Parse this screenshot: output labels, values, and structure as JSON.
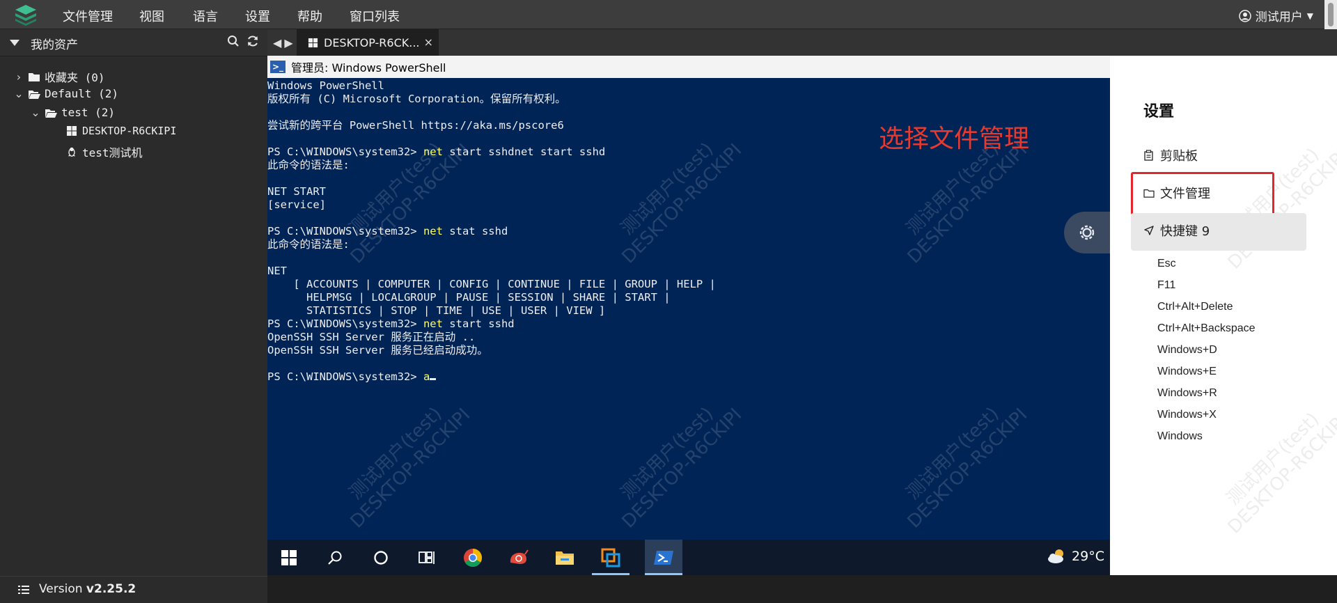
{
  "menubar": {
    "items": [
      "文件管理",
      "视图",
      "语言",
      "设置",
      "帮助",
      "窗口列表"
    ],
    "user": "测试用户"
  },
  "sidebar": {
    "title": "我的资产",
    "tree": [
      {
        "label": "收藏夹 (0)"
      },
      {
        "label": "Default (2)"
      },
      {
        "label": "test (2)"
      },
      {
        "label": "DESKTOP-R6CKIPI"
      },
      {
        "label": "test测试机"
      }
    ],
    "version_label": "Version ",
    "version_value": "v2.25.2"
  },
  "tabbar": {
    "tab_label": "DESKTOP-R6CK...",
    "close_glyph": "×"
  },
  "remote": {
    "window_title": "管理员: Windows PowerShell",
    "terminal_lines": [
      {
        "text": "Windows PowerShell"
      },
      {
        "text": "版权所有 (C) Microsoft Corporation。保留所有权利。"
      },
      {
        "text": ""
      },
      {
        "text": "尝试新的跨平台 PowerShell https://aka.ms/pscore6"
      },
      {
        "text": ""
      },
      {
        "prompt": "PS C:\\WINDOWS\\system32> ",
        "cmd": "net",
        "rest": " start sshdnet start sshd"
      },
      {
        "text": "此命令的语法是:"
      },
      {
        "text": ""
      },
      {
        "text": "NET START"
      },
      {
        "text": "[service]"
      },
      {
        "text": ""
      },
      {
        "prompt": "PS C:\\WINDOWS\\system32> ",
        "cmd": "net",
        "rest": " stat sshd"
      },
      {
        "text": "此命令的语法是:"
      },
      {
        "text": ""
      },
      {
        "text": "NET"
      },
      {
        "text": "    [ ACCOUNTS | COMPUTER | CONFIG | CONTINUE | FILE | GROUP | HELP |"
      },
      {
        "text": "      HELPMSG | LOCALGROUP | PAUSE | SESSION | SHARE | START |"
      },
      {
        "text": "      STATISTICS | STOP | TIME | USE | USER | VIEW ]"
      },
      {
        "prompt": "PS C:\\WINDOWS\\system32> ",
        "cmd": "net",
        "rest": " start sshd"
      },
      {
        "text": "OpenSSH SSH Server 服务正在启动 .."
      },
      {
        "text": "OpenSSH SSH Server 服务已经启动成功。"
      },
      {
        "text": ""
      },
      {
        "prompt": "PS C:\\WINDOWS\\system32> ",
        "cmd": "a",
        "rest": "",
        "cursor": true
      }
    ],
    "annotation": "选择文件管理",
    "watermark": "测试用户(test)\nDESKTOP-R6CKIPI",
    "taskbar": {
      "weather_temp": "29°C"
    }
  },
  "settings": {
    "title": "设置",
    "clipboard": "剪贴板",
    "file_manager": "文件管理",
    "shortcuts": "快捷键 9",
    "keys": [
      "Esc",
      "F11",
      "Ctrl+Alt+Delete",
      "Ctrl+Alt+Backspace",
      "Windows+D",
      "Windows+E",
      "Windows+R",
      "Windows+X",
      "Windows"
    ]
  },
  "colors": {
    "terminal_bg": "#012456",
    "command": "#ffff60",
    "annotation": "#e53a2f",
    "highlight": "#e3262b"
  }
}
